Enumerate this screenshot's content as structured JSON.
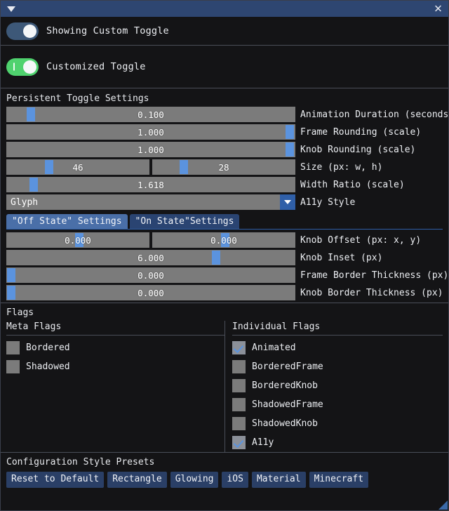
{
  "window": {
    "collapse_icon": "triangle-down-icon",
    "close_icon": "close-icon"
  },
  "top_toggles": [
    {
      "label": "Showing Custom Toggle",
      "state": "on",
      "style": "default",
      "color": "#3d5878"
    },
    {
      "label": "Customized Toggle",
      "state": "on",
      "style": "glyph",
      "color": "#4fd26e"
    }
  ],
  "persistent": {
    "title": "Persistent Toggle Settings",
    "rows": [
      {
        "label": "Animation Duration (seconds)",
        "sliders": [
          {
            "value": "0.100",
            "grab_pct": 7
          }
        ]
      },
      {
        "label": "Frame Rounding (scale)",
        "sliders": [
          {
            "value": "1.000",
            "grab_pct": 97
          }
        ]
      },
      {
        "label": "Knob Rounding (scale)",
        "sliders": [
          {
            "value": "1.000",
            "grab_pct": 97
          }
        ]
      },
      {
        "label": "Size (px: w, h)",
        "sliders": [
          {
            "value": "46",
            "grab_pct": 27
          },
          {
            "value": "28",
            "grab_pct": 19
          }
        ]
      },
      {
        "label": "Width Ratio (scale)",
        "sliders": [
          {
            "value": "1.618",
            "grab_pct": 8
          }
        ]
      }
    ],
    "combo": {
      "label": "A11y Style",
      "value": "Glyph",
      "arrow_icon": "chevron-down-icon"
    }
  },
  "state_tabs": [
    {
      "label": "\"Off State\" Settings",
      "active": true
    },
    {
      "label": "\"On State\"Settings",
      "active": false
    }
  ],
  "state_rows": [
    {
      "label": "Knob Offset (px: x, y)",
      "sliders": [
        {
          "value": "0.000",
          "grab_pct": 50
        },
        {
          "value": "0.000",
          "grab_pct": 50
        }
      ]
    },
    {
      "label": "Knob Inset (px)",
      "sliders": [
        {
          "value": "6.000",
          "grab_pct": 73
        }
      ]
    },
    {
      "label": "Frame Border Thickness (px)",
      "sliders": [
        {
          "value": "0.000",
          "grab_pct": 1
        }
      ]
    },
    {
      "label": "Knob Border Thickness (px)",
      "sliders": [
        {
          "value": "0.000",
          "grab_pct": 1
        }
      ]
    }
  ],
  "flags": {
    "title": "Flags",
    "meta": {
      "header": "Meta Flags",
      "items": [
        {
          "label": "Bordered",
          "checked": false
        },
        {
          "label": "Shadowed",
          "checked": false
        }
      ]
    },
    "individual": {
      "header": "Individual Flags",
      "items": [
        {
          "label": "Animated",
          "checked": true
        },
        {
          "label": "BorderedFrame",
          "checked": false
        },
        {
          "label": "BorderedKnob",
          "checked": false
        },
        {
          "label": "ShadowedFrame",
          "checked": false
        },
        {
          "label": "ShadowedKnob",
          "checked": false
        },
        {
          "label": "A11y",
          "checked": true
        }
      ]
    }
  },
  "presets": {
    "title": "Configuration Style Presets",
    "buttons": [
      "Reset to Default",
      "Rectangle",
      "Glowing",
      "iOS",
      "Material",
      "Minecraft"
    ]
  },
  "colors": {
    "titlebar": "#2e4671",
    "slider_track": "#7b7b7b",
    "slider_grab": "#5b93de",
    "tab_active": "#4a6fa8",
    "tab_inactive": "#2a4472",
    "button": "#2a3f66",
    "toggle_on_green": "#4fd26e",
    "toggle_on_blue": "#3d5878",
    "check": "#5b93de"
  }
}
